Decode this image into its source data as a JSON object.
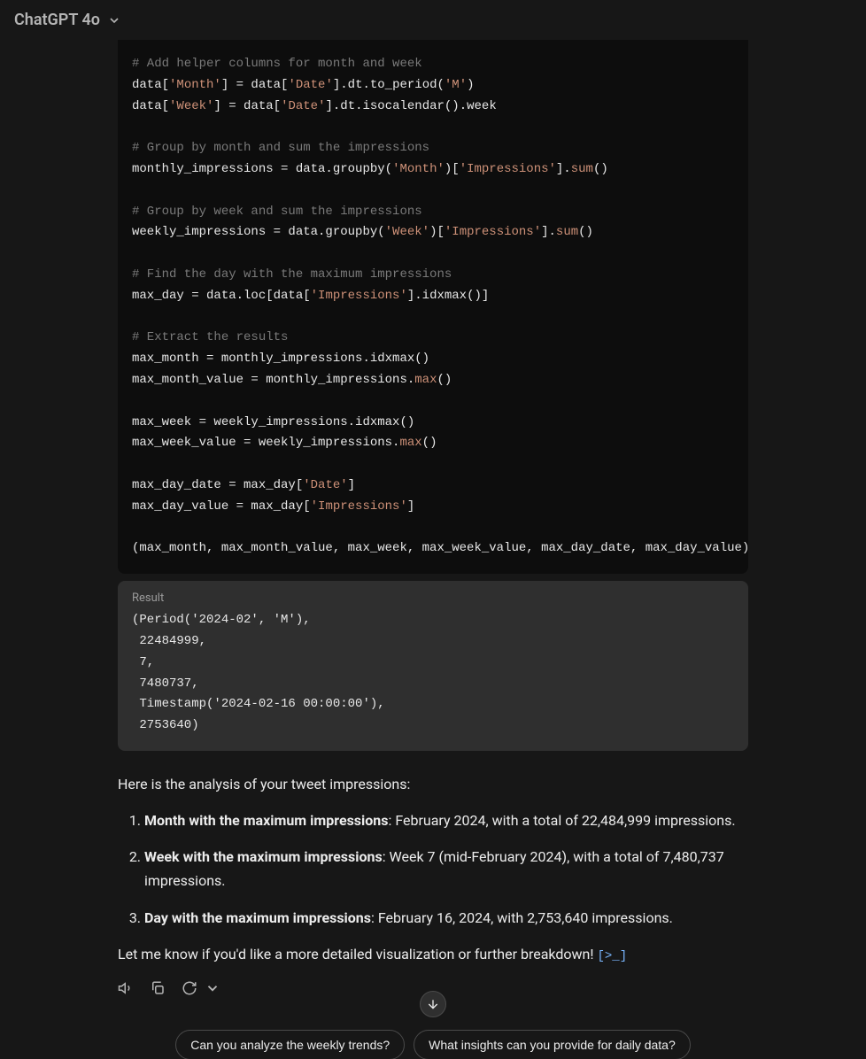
{
  "header": {
    "model": "ChatGPT 4o"
  },
  "code": {
    "l1": "# Add helper columns for month and week",
    "l2a": "data[",
    "l2b": "'Month'",
    "l2c": "] = data[",
    "l2d": "'Date'",
    "l2e": "].dt.to_period(",
    "l2f": "'M'",
    "l2g": ")",
    "l3a": "data[",
    "l3b": "'Week'",
    "l3c": "] = data[",
    "l3d": "'Date'",
    "l3e": "].dt.isocalendar().week",
    "l5": "# Group by month and sum the impressions",
    "l6a": "monthly_impressions = data.groupby(",
    "l6b": "'Month'",
    "l6c": ")[",
    "l6d": "'Impressions'",
    "l6e": "].",
    "l6f": "sum",
    "l6g": "()",
    "l8": "# Group by week and sum the impressions",
    "l9a": "weekly_impressions = data.groupby(",
    "l9b": "'Week'",
    "l9c": ")[",
    "l9d": "'Impressions'",
    "l9e": "].",
    "l9f": "sum",
    "l9g": "()",
    "l11": "# Find the day with the maximum impressions",
    "l12a": "max_day = data.loc[data[",
    "l12b": "'Impressions'",
    "l12c": "].idxmax()]",
    "l14": "# Extract the results",
    "l15": "max_month = monthly_impressions.idxmax()",
    "l16a": "max_month_value = monthly_impressions.",
    "l16b": "max",
    "l16c": "()",
    "l18": "max_week = weekly_impressions.idxmax()",
    "l19a": "max_week_value = weekly_impressions.",
    "l19b": "max",
    "l19c": "()",
    "l21a": "max_day_date = max_day[",
    "l21b": "'Date'",
    "l21c": "]",
    "l22a": "max_day_value = max_day[",
    "l22b": "'Impressions'",
    "l22c": "]",
    "l24": "(max_month, max_month_value, max_week, max_week_value, max_day_date, max_day_value)"
  },
  "result": {
    "label": "Result",
    "body": "(Period('2024-02', 'M'),\n 22484999,\n 7,\n 7480737,\n Timestamp('2024-02-16 00:00:00'),\n 2753640)"
  },
  "prose": {
    "intro": "Here is the analysis of your tweet impressions:",
    "li1_b": "Month with the maximum impressions",
    "li1_r": ": February 2024, with a total of 22,484,999 impressions.",
    "li2_b": "Week with the maximum impressions",
    "li2_r": ": Week 7 (mid-February 2024), with a total of 7,480,737 impressions.",
    "li3_b": "Day with the maximum impressions",
    "li3_r": ": February 16, 2024, with 2,753,640 impressions.",
    "outro": "Let me know if you'd like a more detailed visualization or further breakdown! ",
    "cite": "[>_]"
  },
  "suggestions": {
    "s1": "Can you analyze the weekly trends?",
    "s2": "What insights can you provide for daily data?"
  }
}
